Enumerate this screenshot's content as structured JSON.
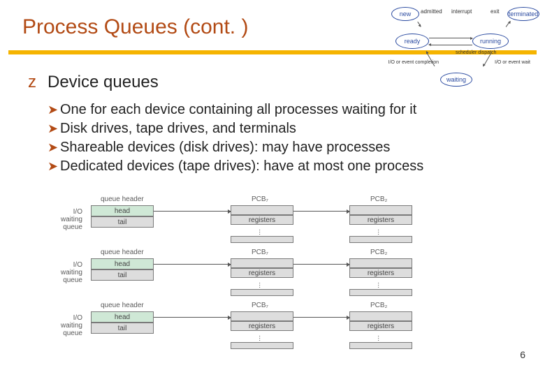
{
  "title": "Process Queues (cont. )",
  "bullet_marker": "z",
  "bullet_main": "Device queues",
  "subbullets": [
    "One for each device containing all processes waiting for it",
    "Disk drives, tape drives, and terminals",
    "Shareable devices (disk drives): may have processes",
    "Dedicated devices (tape drives): have at most one process"
  ],
  "state_diagram": {
    "nodes": [
      "new",
      "ready",
      "running",
      "waiting",
      "terminated"
    ],
    "edge_labels": {
      "admitted": "admitted",
      "interrupt": "interrupt",
      "exit": "exit",
      "dispatch": "scheduler dispatch",
      "io_wait": "I/O or event wait",
      "io_done": "I/O or event completion"
    }
  },
  "queue_diagram": {
    "row_label": "I/O\nwaiting\nqueue",
    "header_label": "queue header",
    "head": "head",
    "tail": "tail",
    "pcb_labels": [
      "PCB₇",
      "PCB₂"
    ],
    "pcb_field": "registers",
    "rows": 3
  },
  "page_number": "6"
}
